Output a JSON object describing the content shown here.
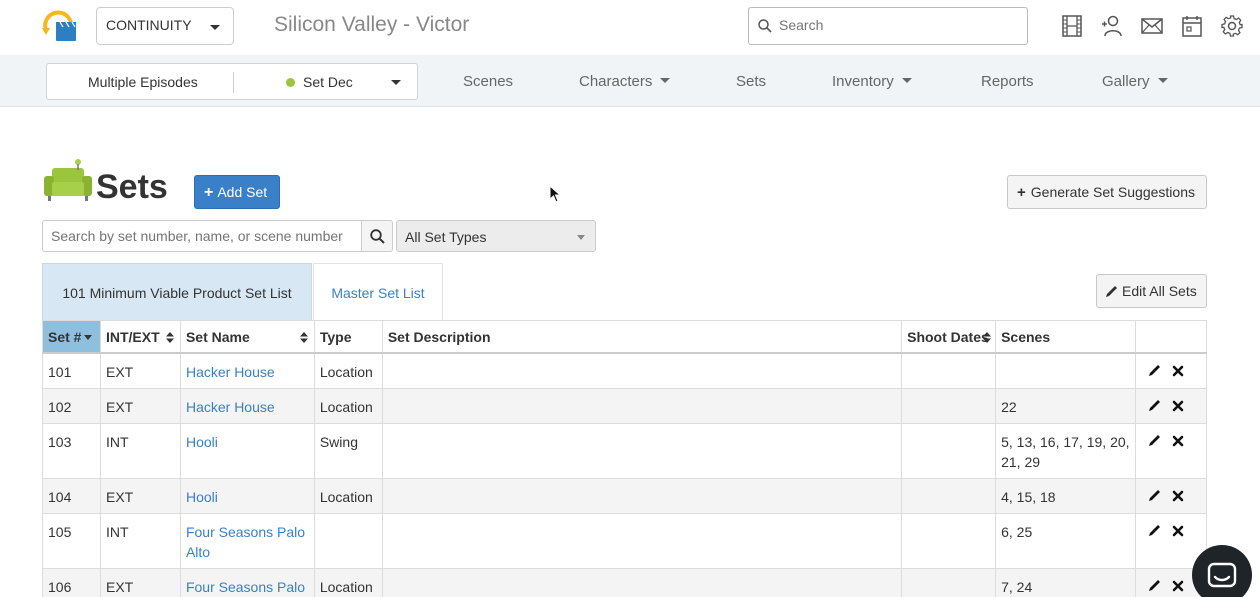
{
  "header": {
    "project": "CONTINUITY",
    "title": "Silicon Valley - Victor",
    "search_placeholder": "Search",
    "icons": [
      "film-icon",
      "add-user-icon",
      "mail-icon",
      "calendar-icon",
      "gear-icon"
    ]
  },
  "nav": {
    "episodes": "Multiple Episodes",
    "department": "Set Dec",
    "department_color": "#9bc53d",
    "items": [
      {
        "label": "Scenes",
        "dropdown": false
      },
      {
        "label": "Characters",
        "dropdown": true
      },
      {
        "label": "Sets",
        "dropdown": false
      },
      {
        "label": "Inventory",
        "dropdown": true
      },
      {
        "label": "Reports",
        "dropdown": false
      },
      {
        "label": "Gallery",
        "dropdown": true
      }
    ]
  },
  "page": {
    "title": "Sets",
    "add_button": "Add Set",
    "generate_button": "Generate Set Suggestions",
    "search_placeholder": "Search by set number, name, or scene number",
    "type_filter": "All Set Types",
    "tabs": [
      "101 Minimum Viable Product Set List",
      "Master Set List"
    ],
    "edit_all_button": "Edit All Sets"
  },
  "table": {
    "headers": [
      "Set #",
      "INT/EXT",
      "Set Name",
      "Type",
      "Set Description",
      "Shoot Dates",
      "Scenes",
      ""
    ],
    "rows": [
      {
        "num": "101",
        "intext": "EXT",
        "name": "Hacker House",
        "type": "Location",
        "desc": "",
        "dates": "",
        "scenes": ""
      },
      {
        "num": "102",
        "intext": "EXT",
        "name": "Hacker House",
        "type": "Location",
        "desc": "",
        "dates": "",
        "scenes": "22"
      },
      {
        "num": "103",
        "intext": "INT",
        "name": "Hooli",
        "type": "Swing",
        "desc": "",
        "dates": "",
        "scenes": "5, 13, 16, 17, 19, 20, 21, 29"
      },
      {
        "num": "104",
        "intext": "EXT",
        "name": "Hooli",
        "type": "Location",
        "desc": "",
        "dates": "",
        "scenes": "4, 15, 18"
      },
      {
        "num": "105",
        "intext": "INT",
        "name": "Four Seasons Palo Alto",
        "type": "",
        "desc": "",
        "dates": "",
        "scenes": "6, 25"
      },
      {
        "num": "106",
        "intext": "EXT",
        "name": "Four Seasons Palo Alto",
        "type": "Location",
        "desc": "",
        "dates": "",
        "scenes": "7, 24"
      }
    ]
  },
  "colors": {
    "accent": "#3a80c8",
    "active_tab": "#d7e8f4",
    "sorted_header": "#8fbfdf",
    "sofa_green": "#9bc53d"
  }
}
